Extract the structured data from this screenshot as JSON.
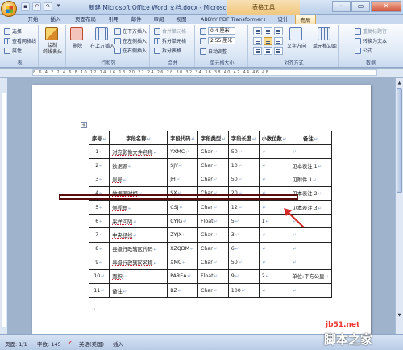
{
  "title_bar": {
    "title": "新建 Microsoft Office Word 文档.docx - Microsoft Word",
    "context_group": "表格工具",
    "min": "─",
    "max": "▭",
    "close": "✕"
  },
  "tabs": [
    "开始",
    "插入",
    "页面布局",
    "引用",
    "邮件",
    "审阅",
    "视图",
    "ABBYY PDF Transformer+",
    "设计",
    "布局"
  ],
  "active_tab": "布局",
  "ribbon": {
    "group_table": {
      "label": "表",
      "select": "选择",
      "gridlines": "查看网格线",
      "properties": "属性"
    },
    "draw": {
      "label": "绘制\n斜线表头"
    },
    "group_rows": {
      "label": "行和列",
      "delete": "删除",
      "insert_above": "在上方插入",
      "insert_below": "在下方插入",
      "insert_left": "在左侧插入",
      "insert_right": "在右侧插入"
    },
    "group_merge": {
      "label": "合并",
      "merge": "合并单元格",
      "split_cells": "拆分单元格",
      "split_table": "拆分表格"
    },
    "group_size": {
      "label": "单元格大小",
      "height": "0.4 厘米",
      "width": "2.55 厘米",
      "autofit": "自动调整"
    },
    "group_align": {
      "label": "对齐方式",
      "direction": "文字方向",
      "margins": "单元格边距"
    },
    "group_data": {
      "label": "数据",
      "repeat_header": "重复标题行",
      "convert_text": "转换为文本",
      "formula": "公式"
    }
  },
  "table": {
    "headers": [
      "序号",
      "字段名称",
      "字段代码",
      "字段类型",
      "字段长度",
      "小数位数",
      "备注"
    ],
    "rows": [
      [
        "1",
        "对应影像文件名称",
        "YXMC",
        "Char",
        "50",
        "",
        ""
      ],
      [
        "2",
        "数据源",
        "SJY",
        "Char",
        "10",
        "",
        "见本表注 1"
      ],
      [
        "3",
        "景号",
        "JH",
        "Char",
        "50",
        "",
        "见附件 1"
      ],
      [
        "4",
        "数据源时相",
        "SX",
        "Char",
        "20",
        "",
        "见本表注 2"
      ],
      [
        "5",
        "侧视角",
        "CSJ",
        "Char",
        "12",
        "",
        "见本表注 3"
      ],
      [
        "6",
        "采样间隔",
        "CYJG",
        "Float",
        "5",
        "1",
        ""
      ],
      [
        "7",
        "中央经线",
        "ZYJX",
        "Char",
        "3",
        "",
        ""
      ],
      [
        "8",
        "县级行政辖区代码",
        "XZQDM",
        "Char",
        "6",
        "",
        ""
      ],
      [
        "9",
        "县级行政辖区名称",
        "XMC",
        "Char",
        "50",
        "",
        ""
      ],
      [
        "10",
        "面积",
        "PAREA",
        "Float",
        "9",
        "2",
        "单位:平方公里"
      ],
      [
        "11",
        "备注",
        "BZ",
        "Char",
        "100",
        "",
        ""
      ]
    ]
  },
  "ruler_text": "8  6  4  2     2  4  6  8  10  12  14  16  18  20  22  24  26  28  30  32  34  36  38  40  42  44  46  48",
  "status": {
    "page": "页面: 1/1",
    "words": "字数: 145",
    "language": "英语(美国)",
    "mode": "插入"
  },
  "watermark": {
    "site": "jb51.net",
    "brand": "脚本之家"
  }
}
